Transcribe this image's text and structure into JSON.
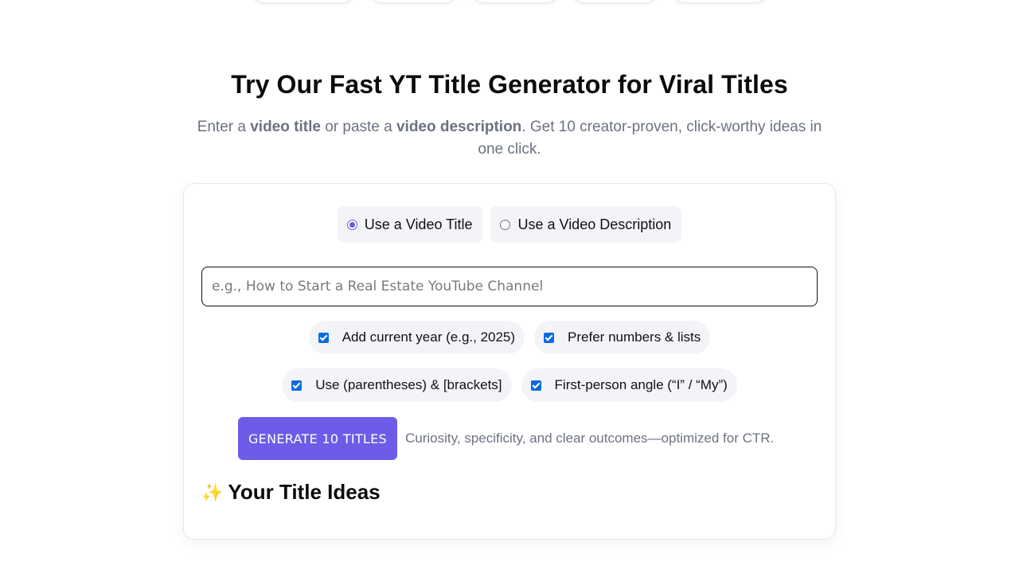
{
  "hero": {
    "title": "Try Our Fast YT Title Generator for Viral Titles",
    "sub_part1": "Enter a ",
    "sub_bold1": "video title",
    "sub_part2": " or paste a ",
    "sub_bold2": "video description",
    "sub_part3": ". Get 10 creator-proven, click-worthy ideas in one click."
  },
  "mode": {
    "options": [
      {
        "label": "Use a Video Title",
        "selected": true
      },
      {
        "label": "Use a Video Description",
        "selected": false
      }
    ]
  },
  "input": {
    "value": "",
    "placeholder": "e.g., How to Start a Real Estate YouTube Channel"
  },
  "options": [
    {
      "label": "Add current year (e.g., 2025)",
      "checked": true
    },
    {
      "label": "Prefer numbers & lists",
      "checked": true
    },
    {
      "label": "Use (parentheses) & [brackets]",
      "checked": true
    },
    {
      "label": "First-person angle (“I” / “My”)",
      "checked": true
    }
  ],
  "generate": {
    "button_label": "GENERATE 10 TITLES",
    "hint": "Curiosity, specificity, and clear outcomes—optimized for CTR."
  },
  "results": {
    "icon": "sparkles-icon",
    "heading": "Your Title Ideas"
  },
  "colors": {
    "accent": "#6c5ce7",
    "checkbox": "#0b6cdf",
    "muted_text": "#6b7280",
    "chip_bg": "#f3f4f8"
  }
}
